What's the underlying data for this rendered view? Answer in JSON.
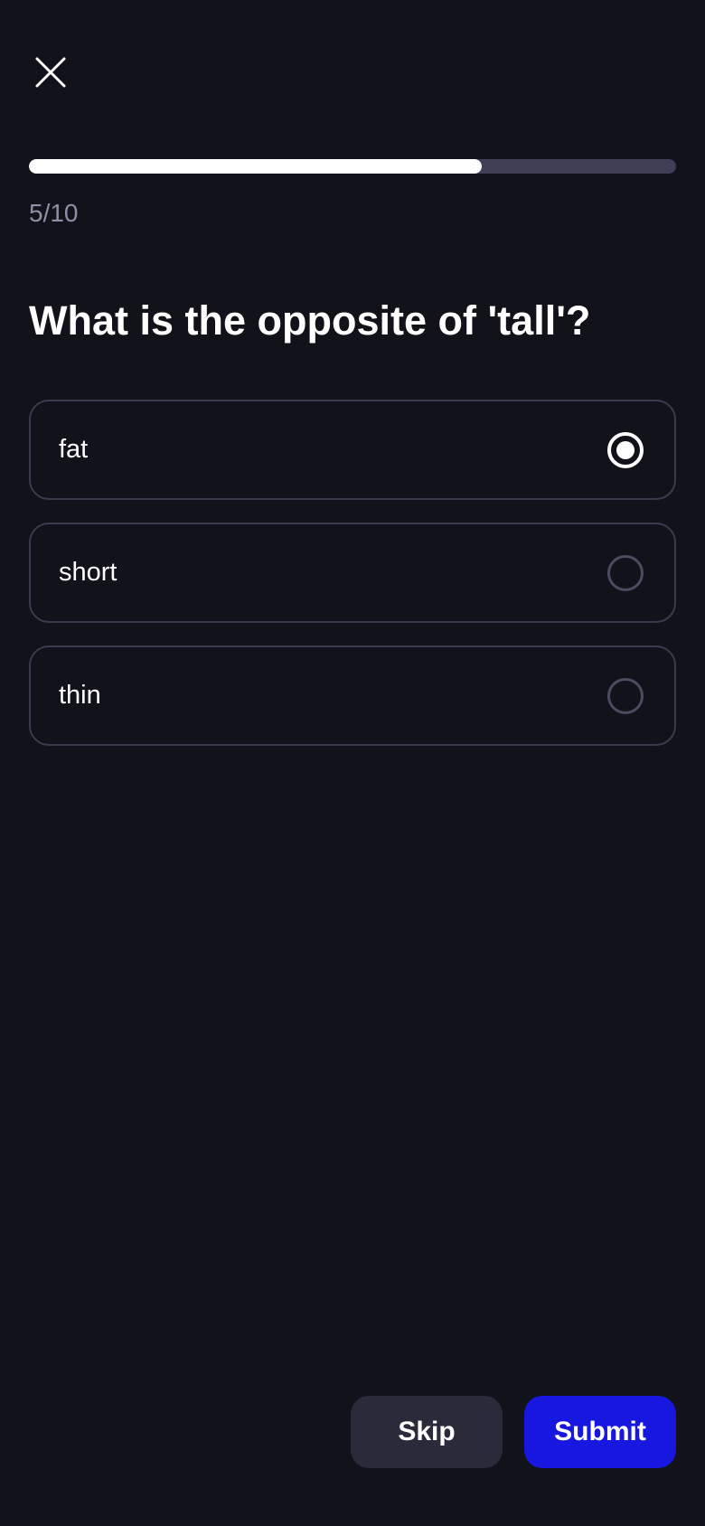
{
  "header": {
    "close_icon": "close-icon"
  },
  "progress": {
    "current": 5,
    "total": 10,
    "fraction": 0.7,
    "text": "5/10"
  },
  "question": {
    "text": "What is the opposite of 'tall'?"
  },
  "options": [
    {
      "label": "fat",
      "selected": true
    },
    {
      "label": "short",
      "selected": false
    },
    {
      "label": "thin",
      "selected": false
    }
  ],
  "actions": {
    "skip_label": "Skip",
    "submit_label": "Submit"
  },
  "colors": {
    "background": "#11121a",
    "accent": "#1717e0",
    "secondary_button": "#2a2a3a",
    "progress_track": "#3f4055",
    "progress_fill": "#ffffff",
    "muted_text": "#8e8fa3",
    "option_border": "#3a3b4c"
  }
}
